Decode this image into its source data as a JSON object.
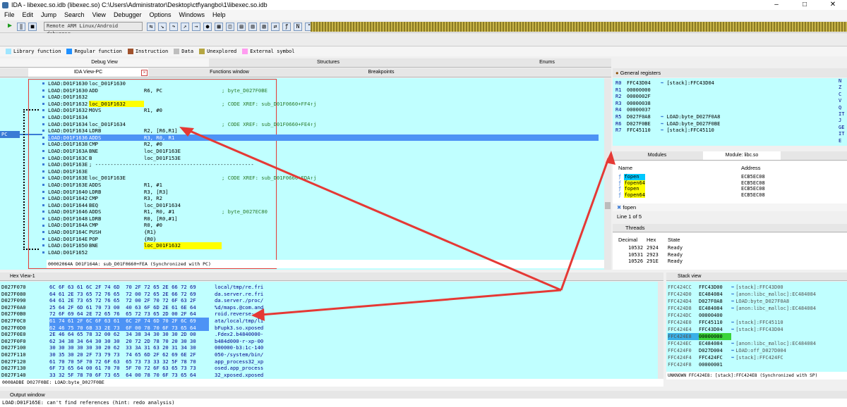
{
  "window": {
    "title": "IDA - libexec.so.idb (libexec.so) C:\\Users\\Administrator\\Desktop\\ctf\\yangbo\\1\\libexec.so.idb"
  },
  "menu": [
    "File",
    "Edit",
    "Jump",
    "Search",
    "View",
    "Debugger",
    "Options",
    "Windows",
    "Help"
  ],
  "toolbar": {
    "debugger": "Remote ARM Linux/Android debugger"
  },
  "legend": [
    {
      "label": "Library function",
      "color": "#a0e6ff"
    },
    {
      "label": "Regular function",
      "color": "#1e90ff"
    },
    {
      "label": "Instruction",
      "color": "#a0522d"
    },
    {
      "label": "Data",
      "color": "#bebebe"
    },
    {
      "label": "Unexplored",
      "color": "#b5a642"
    },
    {
      "label": "External symbol",
      "color": "#ff9cf0"
    }
  ],
  "top_tabs": {
    "debug_view": "Debug View",
    "structures": "Structures",
    "enums": "Enums"
  },
  "sub_tabs": {
    "ida_view": "IDA View-PC",
    "functions": "Functions window",
    "breakpoints": "Breakpoints"
  },
  "pc_label": "PC",
  "disasm": [
    {
      "addr": "LOAD:D01F1630",
      "text": "loc_D01F1630",
      "ops": "",
      "cmt": ""
    },
    {
      "addr": "LOAD:D01F1630",
      "text": "ADD",
      "ops": "R6, PC",
      "cmt": "; byte_D027F0BE"
    },
    {
      "addr": "LOAD:D01F1632",
      "text": "",
      "ops": "",
      "cmt": ""
    },
    {
      "addr": "LOAD:D01F1632",
      "text": "loc_D01F1632",
      "ops": "",
      "cmt": "; CODE XREF: sub_D01F0660+FF4↑j",
      "hl": true
    },
    {
      "addr": "LOAD:D01F1632",
      "text": "MOVS",
      "ops": "R1, #0",
      "cmt": ""
    },
    {
      "addr": "LOAD:D01F1634",
      "text": "",
      "ops": "",
      "cmt": ""
    },
    {
      "addr": "LOAD:D01F1634",
      "text": "loc_D01F1634",
      "ops": "",
      "cmt": "; CODE XREF: sub_D01F0660+FE4↑j"
    },
    {
      "addr": "LOAD:D01F1634",
      "text": "LDRB",
      "ops": "R2, [R6,R1]",
      "cmt": ""
    },
    {
      "addr": "LOAD:D01F1636",
      "text": "ADDS",
      "ops": "R3, R0, R1",
      "cmt": "",
      "sel": true
    },
    {
      "addr": "LOAD:D01F1638",
      "text": "CMP",
      "ops": "R2, #0",
      "cmt": ""
    },
    {
      "addr": "LOAD:D01F163A",
      "text": "BNE",
      "ops": "loc_D01F163E",
      "cmt": ""
    },
    {
      "addr": "LOAD:D01F163C",
      "text": "B",
      "ops": "loc_D01F153E",
      "cmt": ""
    },
    {
      "addr": "LOAD:D01F163E",
      "text": "; ----------------------------------------------------",
      "ops": "",
      "cmt": ""
    },
    {
      "addr": "LOAD:D01F163E",
      "text": "",
      "ops": "",
      "cmt": ""
    },
    {
      "addr": "LOAD:D01F163E",
      "text": "loc_D01F163E",
      "ops": "",
      "cmt": "; CODE XREF: sub_D01F0660+FDA↑j"
    },
    {
      "addr": "LOAD:D01F163E",
      "text": "ADDS",
      "ops": "R1, #1",
      "cmt": ""
    },
    {
      "addr": "LOAD:D01F1640",
      "text": "LDRB",
      "ops": "R3, [R3]",
      "cmt": ""
    },
    {
      "addr": "LOAD:D01F1642",
      "text": "CMP",
      "ops": "R3, R2",
      "cmt": ""
    },
    {
      "addr": "LOAD:D01F1644",
      "text": "BEQ",
      "ops": "loc_D01F1634",
      "cmt": ""
    },
    {
      "addr": "LOAD:D01F1646",
      "text": "ADDS",
      "ops": "R1, R0, #1",
      "cmt": "; byte_D027EC80"
    },
    {
      "addr": "LOAD:D01F1648",
      "text": "LDRB",
      "ops": "R0, [R0,#1]",
      "cmt": ""
    },
    {
      "addr": "LOAD:D01F164A",
      "text": "CMP",
      "ops": "R0, #0",
      "cmt": ""
    },
    {
      "addr": "LOAD:D01F164C",
      "text": "PUSH",
      "ops": "{R1}",
      "cmt": ""
    },
    {
      "addr": "LOAD:D01F164E",
      "text": "POP",
      "ops": "{R0}",
      "cmt": ""
    },
    {
      "addr": "LOAD:D01F1650",
      "text": "BNE",
      "ops": "loc_D01F1632",
      "cmt": "",
      "hlops": true
    },
    {
      "addr": "LOAD:D01F1652",
      "text": "",
      "ops": "",
      "cmt": ""
    }
  ],
  "disasm_status": "00002064A D01F164A: sub_D01F0660+FEA (Synchronized with PC)",
  "registers": {
    "title": "General registers",
    "rows": [
      {
        "r": "R0",
        "v": "FFC43D04",
        "d": "[stack]:FFC43D04"
      },
      {
        "r": "R1",
        "v": "00000000",
        "d": ""
      },
      {
        "r": "R2",
        "v": "0000002F",
        "d": ""
      },
      {
        "r": "R3",
        "v": "00000038",
        "d": ""
      },
      {
        "r": "R4",
        "v": "00000037",
        "d": ""
      },
      {
        "r": "R5",
        "v": "D027F0A8",
        "d": "LOAD:byte_D027F0A8"
      },
      {
        "r": "R6",
        "v": "D027F0BE",
        "d": "LOAD:byte_D027F0BE"
      },
      {
        "r": "R7",
        "v": "FFC45110",
        "d": "[stack]:FFC45110"
      }
    ],
    "flags": [
      "N",
      "Z",
      "C",
      "V",
      "Q",
      "IT",
      "J",
      "GE",
      "IT",
      "E"
    ]
  },
  "modules": {
    "tab1": "Modules",
    "tab2": "Module: libc.so",
    "cols": [
      "Name",
      "Address"
    ],
    "rows": [
      {
        "n": "fopen",
        "a": "ECB5EC08"
      },
      {
        "n": "fopen64",
        "a": "ECB5EC08"
      },
      {
        "n": "fopen",
        "a": "ECB5EC08"
      },
      {
        "n": "fopen64",
        "a": "ECB5EC08"
      }
    ],
    "search": "fopen",
    "status": "Line 1 of 5"
  },
  "threads": {
    "title": "Threads",
    "cols": [
      "Decimal",
      "Hex",
      "State"
    ],
    "rows": [
      {
        "d": "10532",
        "h": "2924",
        "s": "Ready"
      },
      {
        "d": "10531",
        "h": "2923",
        "s": "Ready"
      },
      {
        "d": "10526",
        "h": "291E",
        "s": "Ready"
      }
    ]
  },
  "hex": {
    "title": "Hex View-1",
    "rows": [
      {
        "a": "D027F070",
        "b": "6C 6F 63 61 6C 2F 74 6D  70 2F 72 65 2E 66 72 69",
        "t": "local/tmp/re.fri"
      },
      {
        "a": "D027F080",
        "b": "64 61 2E 73 65 72 76 65  72 00 72 65 2E 66 72 69",
        "t": "da.server.re.fri"
      },
      {
        "a": "D027F090",
        "b": "64 61 2E 73 65 72 76 65  72 00 2F 70 72 6F 63 2F",
        "t": "da.server./proc/"
      },
      {
        "a": "D027F0A0",
        "b": "25 64 2F 6D 61 70 73 00  40 63 6F 6D 2E 61 6E 64",
        "t": "%d/maps.@com.and"
      },
      {
        "a": "D027F0B0",
        "b": "72 6F 69 64 2E 72 65 76  65 72 73 65 2D 00 2F 64",
        "t": "roid.reverse-./d"
      },
      {
        "a": "D027F0C0",
        "b": "61 74 61 2F 6C 6F 63 61  6C 2F 74 6D 70 2F 6C 69",
        "t": "ata/local/tmp/li",
        "sel": true
      },
      {
        "a": "D027F0D0",
        "b": "62 46 75 70 6B 33 2E 73  6F 00 78 70 6F 73 65 64",
        "t": "bFupk3.so.xposed",
        "sel": true
      },
      {
        "a": "D027F0E0",
        "b": "2E 46 64 65 78 32 00 62  34 38 34 30 30 30 2D 00",
        "t": ".Fdex2.b4840000-"
      },
      {
        "a": "D027F0F0",
        "b": "62 34 38 34 64 30 30 30  20 72 2D 78 70 20 30 30",
        "t": "b484d000-r-xp-00"
      },
      {
        "a": "D027F100",
        "b": "30 30 30 30 30 30 20 62  33 3A 31 63 20 31 34 30",
        "t": "000000-b3:1c-140"
      },
      {
        "a": "D027F110",
        "b": "30 35 30 20 2F 73 79 73  74 65 6D 2F 62 69 6E 2F",
        "t": "050-/system/bin/"
      },
      {
        "a": "D027F120",
        "b": "61 70 70 5F 70 72 6F 63  65 73 73 33 32 5F 78 70",
        "t": "app_process32_xp"
      },
      {
        "a": "D027F130",
        "b": "6F 73 65 64 00 61 70 70  5F 70 72 6F 63 65 73 73",
        "t": "osed.app_process"
      },
      {
        "a": "D027F140",
        "b": "33 32 5F 78 70 6F 73 65  64 00 78 70 6F 73 65 64",
        "t": "32_xposed.xposed"
      }
    ],
    "status": "0008ADBE D027F0BE: LOAD:byte_D027F0BE"
  },
  "stack": {
    "title": "Stack view",
    "rows": [
      {
        "a": "FFC424CC",
        "v": "FFC43D00",
        "d": "[stack]:FFC43D00"
      },
      {
        "a": "FFC424D0",
        "v": "EC484084",
        "d": "[anon:libc_malloc]:EC484084"
      },
      {
        "a": "FFC424D4",
        "v": "D027F0A8",
        "d": "LOAD:byte_D027F0A8"
      },
      {
        "a": "FFC424D8",
        "v": "EC484084",
        "d": "[anon:libc_malloc]:EC484084"
      },
      {
        "a": "FFC424DC",
        "v": "00000400",
        "d": ""
      },
      {
        "a": "FFC424E0",
        "v": "FFC45110",
        "d": "[stack]:FFC45110"
      },
      {
        "a": "FFC424E4",
        "v": "FFC43D04",
        "d": "[stack]:FFC43D04"
      },
      {
        "a": "FFC424E8",
        "v": "00000000",
        "d": "",
        "sel": true
      },
      {
        "a": "FFC424EC",
        "v": "EC484084",
        "d": "[anon:libc_malloc]:EC484084"
      },
      {
        "a": "FFC424F0",
        "v": "D027D004",
        "d": "LOAD:off_D027D004"
      },
      {
        "a": "FFC424F4",
        "v": "FFC424FC",
        "d": "[stack]:FFC424FC"
      },
      {
        "a": "FFC424F8",
        "v": "00000001",
        "d": ""
      }
    ],
    "status": "UNKNOWN FFC424E8: [stack]:FFC424E8 (Synchronized with SP)"
  },
  "output": {
    "title": "Output window",
    "line": "LOAD:D01F165E: can't find references (hint: redo analysis)"
  },
  "colors": {
    "panel": "#c0ffff",
    "highlight": "#ffff00",
    "selection": "#4d93f5",
    "arrow": "#e53935"
  }
}
